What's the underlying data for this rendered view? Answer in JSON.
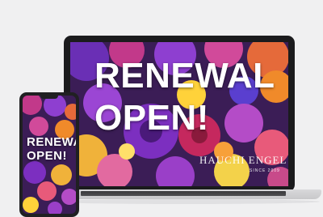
{
  "laptop": {
    "headline_line1": "RENEWAL",
    "headline_line2": "OPEN!",
    "brand_name": "HAUCHI ENGEL",
    "brand_tagline": "SINCE 2009"
  },
  "phone": {
    "headline_line1": "RENEWAL",
    "headline_line2": "OPEN!"
  },
  "colors": {
    "background": "#f0f0f1",
    "device_frame": "#1b1b1d",
    "flower_palette": [
      "#8e3fd0",
      "#d53a8c",
      "#f08a2a",
      "#ffd23a",
      "#5a3fcf",
      "#e85a7a",
      "#b44cc7"
    ]
  }
}
